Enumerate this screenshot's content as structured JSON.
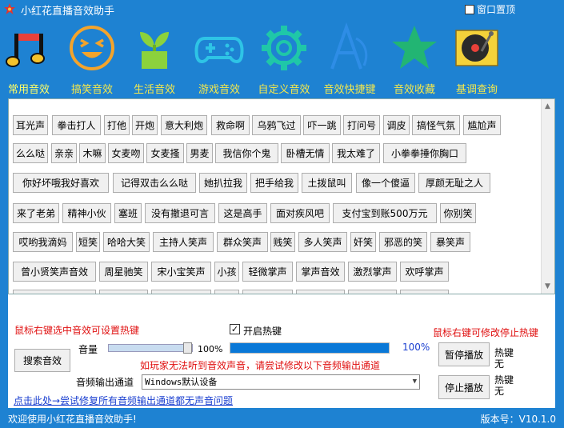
{
  "window": {
    "title": "小红花直播音效助手",
    "pin_label": "窗口置顶"
  },
  "categories": [
    {
      "label": "常用音效",
      "icon": "music-note-icon"
    },
    {
      "label": "搞笑音效",
      "icon": "laughing-face-icon"
    },
    {
      "label": "生活音效",
      "icon": "plant-pot-icon"
    },
    {
      "label": "游戏音效",
      "icon": "gamepad-icon"
    },
    {
      "label": "自定义音效",
      "icon": "gear-icon"
    },
    {
      "label": "音效快捷键",
      "icon": "letter-a-icon"
    },
    {
      "label": "音效收藏",
      "icon": "star-icon"
    },
    {
      "label": "基调查询",
      "icon": "turntable-icon"
    }
  ],
  "sounds": [
    [
      "耳光声",
      "拳击打人",
      "打他",
      "开炮",
      "意大利炮",
      "救命啊",
      "乌鸦飞过",
      "吓一跳",
      "打问号",
      "调皮",
      "搞怪气氛",
      "尴尬声"
    ],
    [
      "么么哒",
      "亲亲",
      "木嘛",
      "女麦吻",
      "女麦搔",
      "男麦",
      "我信你个鬼",
      "卧槽无情",
      "我太难了",
      "小拳拳捶你胸口"
    ],
    [
      "你好坏哦我好喜欢",
      "记得双击么么哒",
      "她扒拉我",
      "把手给我",
      "土拨鼠叫",
      "像一个傻逼",
      "厚颜无耻之人"
    ],
    [
      "来了老弟",
      "精神小伙",
      "塞班",
      "没有撤退可言",
      "这是高手",
      "面对疾风吧",
      "支付宝到账500万元",
      "你别笑"
    ],
    [
      "哎哟我滴妈",
      "短笑",
      "哈哈大笑",
      "主持人笑声",
      "群众笑声",
      "贱笑",
      "多人笑声",
      "奸笑",
      "邪恶的笑",
      "暴笑声"
    ],
    [
      "曾小贤笑声音效",
      "周星驰笑",
      "宋小宝笑声",
      "小孩",
      "轻微掌声",
      "掌声音效",
      "激烈掌声",
      "欢呼掌声"
    ]
  ],
  "panel": {
    "hotkey_hint": "鼠标右键选中音效可设置热键",
    "enable_hotkey_label": "开启热键",
    "stop_hint": "鼠标右键可修改停止热键",
    "search_button": "搜索音效",
    "volume_label": "音量",
    "volume_value": "100%",
    "volume": 1.0,
    "progress_value": "100%",
    "progress": 1.0,
    "audio_warning": "如玩家无法听到音效声音，请尝试修改以下音频输出通道",
    "output_label": "音频输出通道",
    "output_selected": "Windows默认设备",
    "pause_button": "暂停播放",
    "pause_hotkey_label": "热键",
    "pause_hotkey_value": "无",
    "stop_button": "停止播放",
    "stop_hotkey_label": "热键",
    "stop_hotkey_value": "无",
    "repair_link": "点击此处→尝试修复所有音频输出通道都无声音问题"
  },
  "status": {
    "welcome": "欢迎使用小红花直播音效助手!",
    "version": "版本号：V10.1.0"
  },
  "colors": {
    "window_blue": "#1e82d2",
    "category_label": "#f5e84c",
    "hint_red": "#e01010",
    "progress_fill": "#0a78d7",
    "link_blue": "#1a3fd0"
  }
}
